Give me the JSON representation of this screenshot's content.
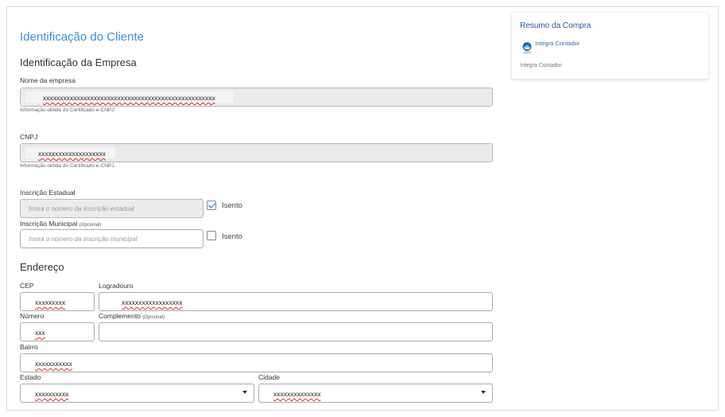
{
  "main": {
    "title": "Identificação do Cliente",
    "company_section": "Identificação da Empresa",
    "company_name": {
      "label": "Nome da empresa",
      "value": "xxxxxxxxxxxxxxxxxxxxxxxxxxxxxxxxxxxxxxxxxxxxxxxxxxx",
      "help": "Informação obtida do Certificado e-CNPJ."
    },
    "cnpj": {
      "label": "CNPJ",
      "value": "xxxxxxxxxxxxxxxxxxxx",
      "help": "Informação obtida do Certificado e-CNPJ."
    },
    "state_registration": {
      "label": "Inscrição Estadual",
      "placeholder": "Insira o número da inscrição estadual",
      "exempt_label": "Isento",
      "exempt_checked": true
    },
    "municipal_registration": {
      "label": "Inscrição Municipal",
      "optional": "(Opcional)",
      "placeholder": "Insira o número da inscrição municipal",
      "exempt_label": "Isento",
      "exempt_checked": false
    },
    "address_section": "Endereço",
    "address": {
      "cep": {
        "label": "CEP",
        "value": "xxxxxxxxx"
      },
      "street": {
        "label": "Logradouro",
        "value": "xxxxxxxxxxxxxxxxxx"
      },
      "number": {
        "label": "Número",
        "value": "xxx"
      },
      "complement": {
        "label": "Complemento",
        "optional": "(Opcional)",
        "value": ""
      },
      "district": {
        "label": "Bairro",
        "value": "xxxxxxxxxxx"
      },
      "state": {
        "label": "Estado",
        "value": "xxxxxxxxxx"
      },
      "city": {
        "label": "Cidade",
        "value": "xxxxxxxxxxxxxx"
      }
    }
  },
  "summary": {
    "title": "Resumo da Compra",
    "product_link": "Integra Contador",
    "product_name": "Integra Contador",
    "logo_icon": "integra-contador-logo-icon"
  },
  "colors": {
    "title_blue": "#3d8fd6",
    "summary_blue": "#2b5797",
    "spellcheck_red": "#e0312a"
  }
}
